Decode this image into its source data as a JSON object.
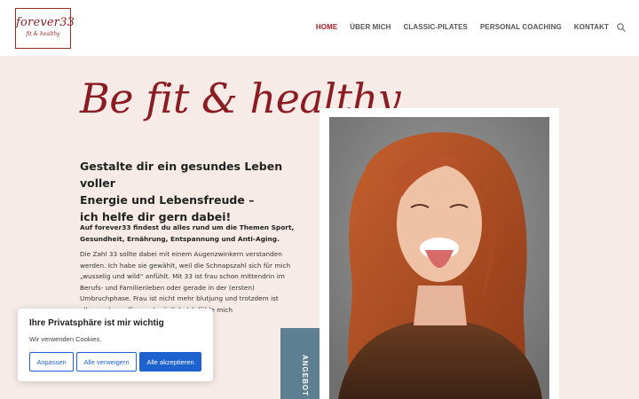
{
  "header": {
    "logo_main": "forever33",
    "logo_sub": "fit & healthy",
    "nav": [
      {
        "label": "HOME",
        "active": true
      },
      {
        "label": "ÜBER MICH",
        "active": false
      },
      {
        "label": "CLASSIC-PILATES",
        "active": false
      },
      {
        "label": "PERSONAL COACHING",
        "active": false
      },
      {
        "label": "KONTAKT",
        "active": false
      }
    ]
  },
  "hero": {
    "headline": "Be fit & healthy",
    "subheadline_line1": "Gestalte dir ein gesundes Leben voller",
    "subheadline_line2": "Energie und Lebensfreude –",
    "subheadline_line3": "ich helfe dir gern dabei!",
    "intro": "Auf forever33 findest du alles rund um die Themen Sport, Gesundheit, Ernährung, Entspannung und Anti-Aging.",
    "body": "Die Zahl 33 sollte dabei mit einem Augenzwinkern verstanden werden. Ich habe sie gewählt, weil die Schnapszahl sich für mich „wusselig und wild“ anfühlt. Mit 33 ist frau schon mittendrin im Berufs- und Familienleben oder gerade in der (ersten) Umbruchphase. Frau ist nicht mehr blutjung und trotzdem ist alles noch so offen und möglich. Ich fühle mich"
  },
  "side_tab": {
    "label": "ANGEBOT"
  },
  "cookie": {
    "title": "Ihre Privatsphäre ist mir wichtig",
    "text": "Wir verwenden Cookies.",
    "btn_customize": "Anpassen",
    "btn_reject": "Alle verweigern",
    "btn_accept": "Alle akzeptieren"
  },
  "colors": {
    "accent": "#a01f24",
    "background": "#f6ebe6",
    "tab": "#5e7f91",
    "button": "#1e62d0"
  }
}
